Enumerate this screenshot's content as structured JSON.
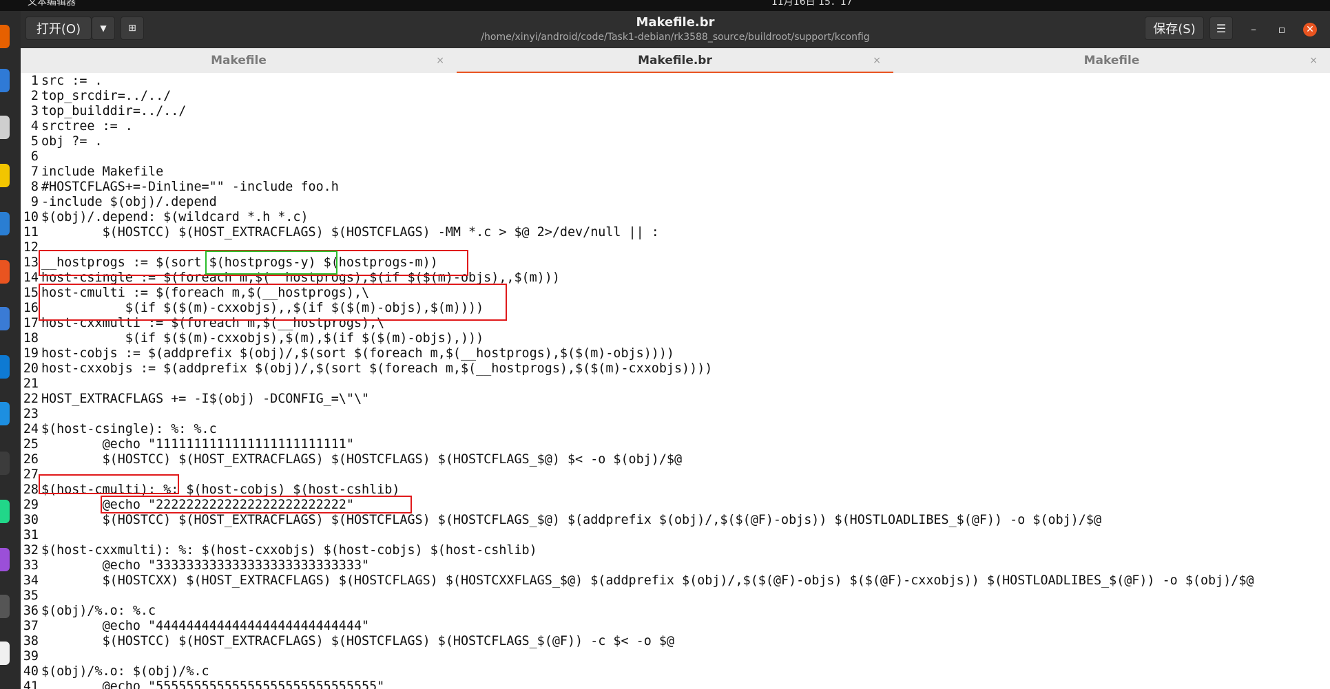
{
  "system_bar": {
    "app_name": "文本编辑器",
    "clock": "11月16日 15：17"
  },
  "header": {
    "open_label": "打开(O)",
    "title": "Makefile.br",
    "subtitle": "/home/xinyi/android/code/Task1-debian/rk3588_source/buildroot/support/kconfig",
    "save_label": "保存(S)"
  },
  "tabs": [
    {
      "label": "Makefile",
      "close": "×"
    },
    {
      "label": "Makefile.br",
      "close": "×"
    },
    {
      "label": "Makefile",
      "close": "×"
    }
  ],
  "editor": {
    "lines": [
      {
        "n": "1",
        "t": "src := ."
      },
      {
        "n": "2",
        "t": "top_srcdir=../../"
      },
      {
        "n": "3",
        "t": "top_builddir=../../"
      },
      {
        "n": "4",
        "t": "srctree := ."
      },
      {
        "n": "5",
        "t": "obj ?= ."
      },
      {
        "n": "6",
        "t": ""
      },
      {
        "n": "7",
        "t": "include Makefile"
      },
      {
        "n": "8",
        "t": "#HOSTCFLAGS+=-Dinline=\"\" -include foo.h"
      },
      {
        "n": "9",
        "t": "-include $(obj)/.depend"
      },
      {
        "n": "10",
        "t": "$(obj)/.depend: $(wildcard *.h *.c)"
      },
      {
        "n": "11",
        "t": "        $(HOSTCC) $(HOST_EXTRACFLAGS) $(HOSTCFLAGS) -MM *.c > $@ 2>/dev/null || :"
      },
      {
        "n": "12",
        "t": ""
      },
      {
        "n": "13",
        "t": "__hostprogs := $(sort $(hostprogs-y) $(hostprogs-m))"
      },
      {
        "n": "14",
        "t": "host-csingle := $(foreach m,$(__hostprogs),$(if $($(m)-objs),,$(m)))"
      },
      {
        "n": "15",
        "t": "host-cmulti := $(foreach m,$(__hostprogs),\\"
      },
      {
        "n": "16",
        "t": "           $(if $($(m)-cxxobjs),,$(if $($(m)-objs),$(m))))"
      },
      {
        "n": "17",
        "t": "host-cxxmulti := $(foreach m,$(__hostprogs),\\"
      },
      {
        "n": "18",
        "t": "           $(if $($(m)-cxxobjs),$(m),$(if $($(m)-objs),)))"
      },
      {
        "n": "19",
        "t": "host-cobjs := $(addprefix $(obj)/,$(sort $(foreach m,$(__hostprogs),$($(m)-objs))))"
      },
      {
        "n": "20",
        "t": "host-cxxobjs := $(addprefix $(obj)/,$(sort $(foreach m,$(__hostprogs),$($(m)-cxxobjs))))"
      },
      {
        "n": "21",
        "t": ""
      },
      {
        "n": "22",
        "t": "HOST_EXTRACFLAGS += -I$(obj) -DCONFIG_=\\\"\\\""
      },
      {
        "n": "23",
        "t": ""
      },
      {
        "n": "24",
        "t": "$(host-csingle): %: %.c"
      },
      {
        "n": "25",
        "t": "        @echo \"1111111111111111111111111\""
      },
      {
        "n": "26",
        "t": "        $(HOSTCC) $(HOST_EXTRACFLAGS) $(HOSTCFLAGS) $(HOSTCFLAGS_$@) $< -o $(obj)/$@"
      },
      {
        "n": "27",
        "t": ""
      },
      {
        "n": "28",
        "t": "$(host-cmulti): %: $(host-cobjs) $(host-cshlib)"
      },
      {
        "n": "29",
        "t": "        @echo \"2222222222222222222222222\""
      },
      {
        "n": "30",
        "t": "        $(HOSTCC) $(HOST_EXTRACFLAGS) $(HOSTCFLAGS) $(HOSTCFLAGS_$@) $(addprefix $(obj)/,$($(@F)-objs)) $(HOSTLOADLIBES_$(@F)) -o $(obj)/$@"
      },
      {
        "n": "31",
        "t": ""
      },
      {
        "n": "32",
        "t": "$(host-cxxmulti): %: $(host-cxxobjs) $(host-cobjs) $(host-cshlib)"
      },
      {
        "n": "33",
        "t": "        @echo \"333333333333333333333333333\""
      },
      {
        "n": "34",
        "t": "        $(HOSTCXX) $(HOST_EXTRACFLAGS) $(HOSTCFLAGS) $(HOSTCXXFLAGS_$@) $(addprefix $(obj)/,$($(@F)-objs) $($(@F)-cxxobjs)) $(HOSTLOADLIBES_$(@F)) -o $(obj)/$@"
      },
      {
        "n": "35",
        "t": ""
      },
      {
        "n": "36",
        "t": "$(obj)/%.o: %.c"
      },
      {
        "n": "37",
        "t": "        @echo \"444444444444444444444444444\""
      },
      {
        "n": "38",
        "t": "        $(HOSTCC) $(HOST_EXTRACFLAGS) $(HOSTCFLAGS) $(HOSTCFLAGS_$(@F)) -c $< -o $@"
      },
      {
        "n": "39",
        "t": ""
      },
      {
        "n": "40",
        "t": "$(obj)/%.o: $(obj)/%.c"
      },
      {
        "n": "41",
        "t": "        @echo \"55555555555555555555555555555\""
      }
    ]
  },
  "annotation_colors": {
    "red": "#e0191b",
    "green": "#2bbd2b"
  }
}
